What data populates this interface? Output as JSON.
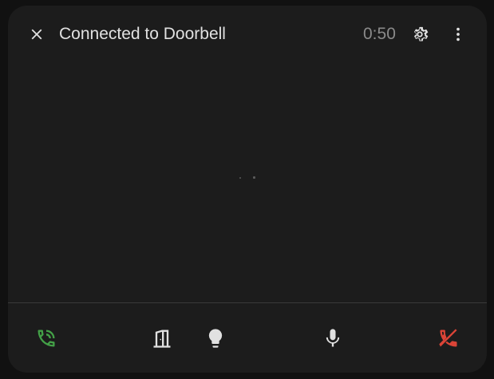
{
  "header": {
    "title": "Connected to Doorbell",
    "timer": "0:50",
    "close_icon": "close-icon",
    "settings_icon": "gear-icon",
    "menu_icon": "more-vertical-icon"
  },
  "actions": {
    "answer_icon": "phone-in-talk-icon",
    "door_icon": "door-open-icon",
    "light_icon": "lightbulb-icon",
    "mic_icon": "microphone-icon",
    "hangup_icon": "phone-hangup-icon"
  },
  "colors": {
    "background": "#1c1c1c",
    "text": "#e1e1e1",
    "muted": "#8a8a8a",
    "answer": "#43a047",
    "hangup": "#db4437",
    "icon": "#e1e1e1"
  }
}
